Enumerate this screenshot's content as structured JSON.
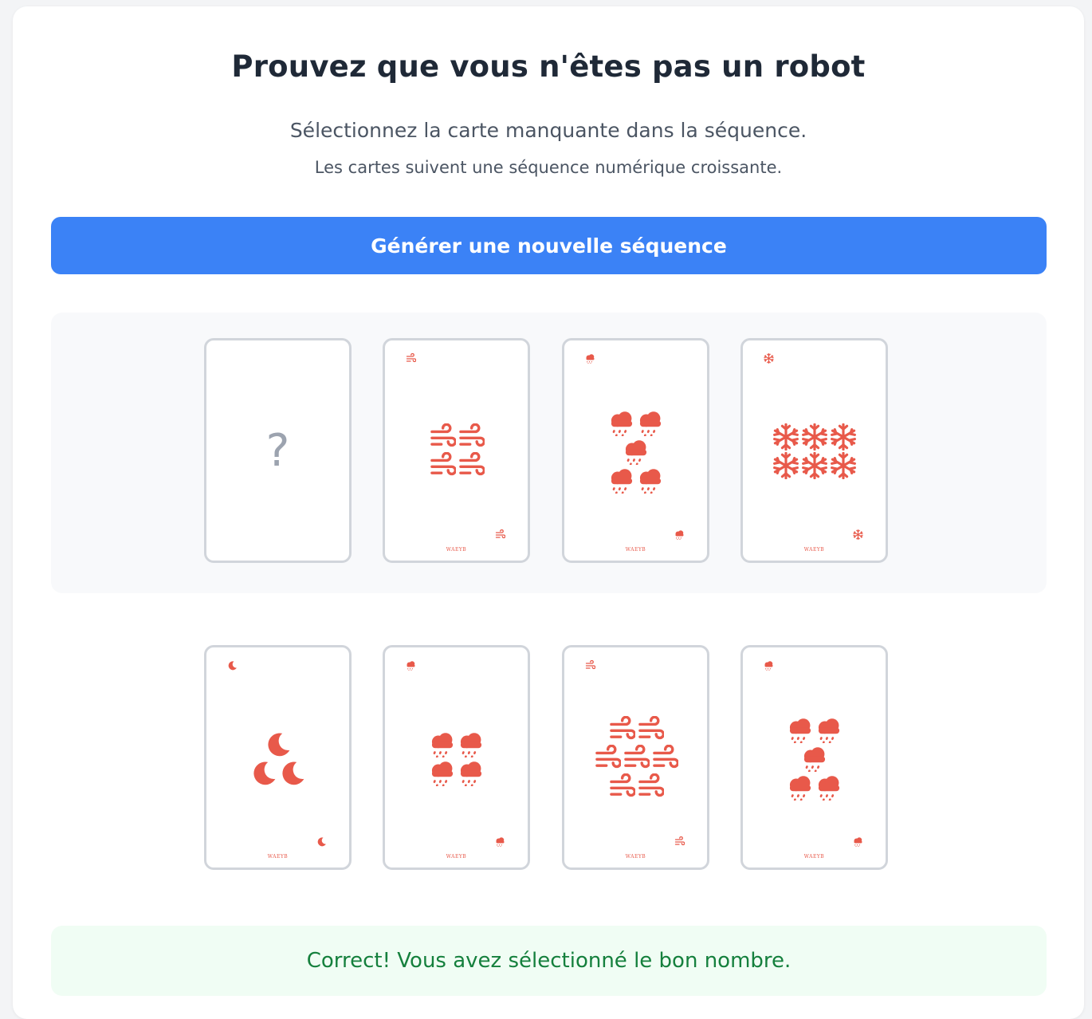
{
  "title": "Prouvez que vous n'êtes pas un robot",
  "subtitle": "Sélectionnez la carte manquante dans la séquence.",
  "hint": "Les cartes suivent une séquence numérique croissante.",
  "generate_button": "Générer une nouvelle séquence",
  "missing_placeholder": "?",
  "brand_text": "WAEYB",
  "suit_color": "#e8594a",
  "sequence_cards": [
    {
      "missing": true
    },
    {
      "suit": "wind-icon",
      "count": 4
    },
    {
      "suit": "rain-cloud-icon",
      "count": 5
    },
    {
      "suit": "snowflake-icon",
      "count": 6
    }
  ],
  "option_cards": [
    {
      "suit": "moon-icon",
      "count": 3
    },
    {
      "suit": "rain-cloud-icon",
      "count": 4
    },
    {
      "suit": "wind-icon",
      "count": 7
    },
    {
      "suit": "rain-cloud-icon",
      "count": 5
    }
  ],
  "result_message": "Correct! Vous avez sélectionné le bon nombre."
}
